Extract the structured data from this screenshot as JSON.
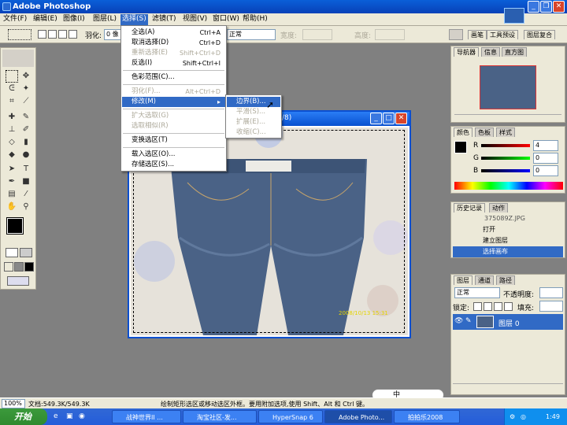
{
  "app": {
    "title": "Adobe Photoshop"
  },
  "menubar": {
    "items": [
      "文件(F)",
      "编辑(E)",
      "图像(I)",
      "图层(L)",
      "选择(S)",
      "滤镜(T)",
      "视图(V)",
      "窗口(W)",
      "帮助(H)"
    ]
  },
  "options": {
    "feather_label": "羽化:",
    "feather_value": "0 像",
    "style_value": "正常",
    "width_label": "宽度:",
    "height_label": "高度:",
    "palette_tabs": [
      "画笔",
      "工具预设",
      "图层复合"
    ]
  },
  "select_menu": {
    "items": [
      {
        "label": "全选(A)",
        "shortcut": "Ctrl+A",
        "disabled": false
      },
      {
        "label": "取消选择(D)",
        "shortcut": "Ctrl+D",
        "disabled": false
      },
      {
        "label": "重新选择(E)",
        "shortcut": "Shift+Ctrl+D",
        "disabled": true
      },
      {
        "label": "反选(I)",
        "shortcut": "Shift+Ctrl+I",
        "disabled": false
      },
      {
        "label": "色彩范围(C)...",
        "shortcut": "",
        "disabled": false
      },
      {
        "label": "羽化(F)...",
        "shortcut": "Alt+Ctrl+D",
        "disabled": true
      },
      {
        "label": "修改(M)",
        "shortcut": "",
        "disabled": false
      },
      {
        "label": "扩大选取(G)",
        "shortcut": "",
        "disabled": true
      },
      {
        "label": "选取相似(R)",
        "shortcut": "",
        "disabled": true
      },
      {
        "label": "变换选区(T)",
        "shortcut": "",
        "disabled": false
      },
      {
        "label": "载入选区(O)...",
        "shortcut": "",
        "disabled": false
      },
      {
        "label": "存储选区(S)...",
        "shortcut": "",
        "disabled": false
      }
    ]
  },
  "modify_submenu": {
    "items": [
      "边界(B)...",
      "平滑(S)...",
      "扩展(E)...",
      "收缩(C)..."
    ]
  },
  "document": {
    "title_suffix": "/8)",
    "photo_timestamp": "2008/10/13 15:31"
  },
  "navigator": {
    "tabs": [
      "导航器",
      "信息",
      "直方图"
    ]
  },
  "color_panel": {
    "tabs": [
      "颜色",
      "色板",
      "样式"
    ],
    "channels": [
      {
        "name": "R",
        "value": "4"
      },
      {
        "name": "G",
        "value": "0"
      },
      {
        "name": "B",
        "value": "0"
      }
    ]
  },
  "history_panel": {
    "tabs": [
      "历史记录",
      "动作"
    ],
    "snapshot": "375089Z.JPG",
    "items": [
      "打开",
      "建立图层",
      "选择画布"
    ]
  },
  "layers_panel": {
    "tabs": [
      "图层",
      "通道",
      "路径"
    ],
    "blend_mode": "正常",
    "opacity_label": "不透明度:",
    "lock_label": "锁定:",
    "fill_label": "填充:",
    "layer_name": "图层 0"
  },
  "status": {
    "zoom": "100%",
    "doc_size": "文档:549.3K/549.3K",
    "hint": "绘制矩形选区或移动选区外框。要用附加选项,使用 Shift、Alt 和 Ctrl 键。"
  },
  "taskbar": {
    "start": "开始",
    "tasks": [
      "战神世界II ...",
      "淘宝社区-发...",
      "HyperSnap 6",
      "Adobe Photo...",
      "拍拍乐2008"
    ],
    "time": "1:49",
    "ime": "中"
  },
  "colors": {
    "accent": "#316ac5",
    "titlebar": "#0841b8",
    "menu_bg": "#ece9d8",
    "workspace": "#808080"
  }
}
